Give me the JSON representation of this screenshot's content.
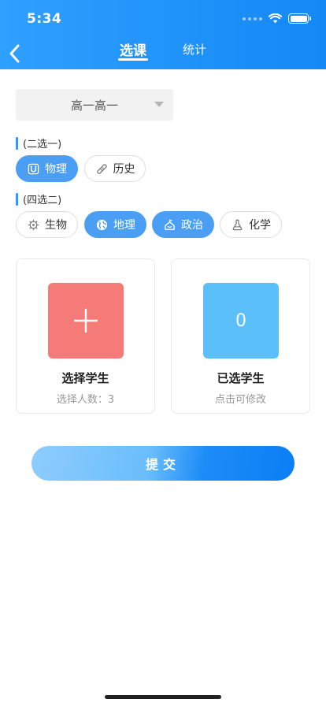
{
  "status_bar": {
    "time": "5:34"
  },
  "nav": {
    "tabs": [
      {
        "label": "选课",
        "active": true
      },
      {
        "label": "统计",
        "active": false
      }
    ]
  },
  "class_select": {
    "value": "高一高一"
  },
  "group_two": {
    "label": "(二选一)",
    "options": [
      {
        "label": "物理",
        "icon": "magnet-icon",
        "selected": true
      },
      {
        "label": "历史",
        "icon": "scroll-icon",
        "selected": false
      }
    ]
  },
  "group_four": {
    "label": "(四选二)",
    "options": [
      {
        "label": "生物",
        "icon": "virus-icon",
        "selected": false
      },
      {
        "label": "地理",
        "icon": "globe-icon",
        "selected": true
      },
      {
        "label": "政治",
        "icon": "government-icon",
        "selected": true
      },
      {
        "label": "化学",
        "icon": "flask-icon",
        "selected": false
      }
    ]
  },
  "cards": {
    "choose": {
      "tile": "+",
      "title": "选择学生",
      "subtitle": "选择人数：3",
      "color": "#f47b78"
    },
    "chosen": {
      "tile": "0",
      "title": "已选学生",
      "subtitle": "点击可修改",
      "color": "#5bc0fa"
    }
  },
  "submit": {
    "label": "提交"
  },
  "colors": {
    "primary": "#1c8df5",
    "chip_active": "#4a9ff5"
  }
}
